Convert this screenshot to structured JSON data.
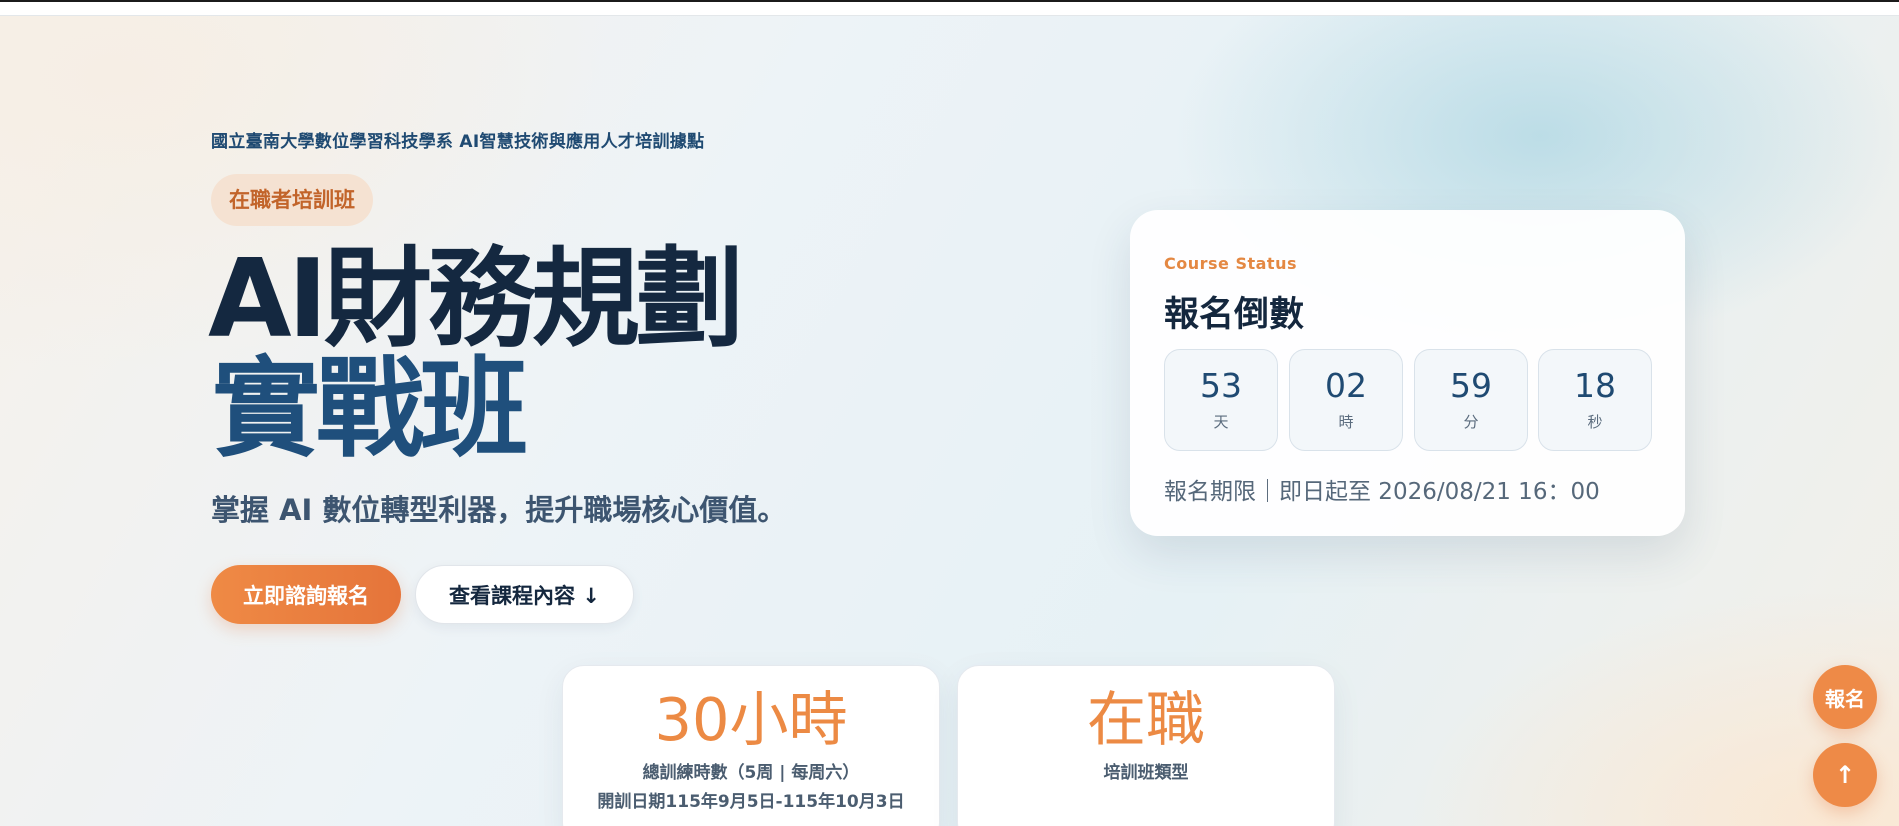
{
  "hero": {
    "institution": "國立臺南大學數位學習科技學系 AI智慧技術與應用人才培訓據點",
    "badge": "在職者培訓班",
    "title_line1": "AI財務規劃",
    "title_line2": "實戰班",
    "subtitle": "掌握 AI 數位轉型利器，提升職場核心價值。",
    "primary_button": "立即諮詢報名",
    "secondary_button": "查看課程內容 ↓"
  },
  "status": {
    "eyebrow": "Course Status",
    "title": "報名倒數",
    "countdown": [
      {
        "value": "53",
        "unit": "天"
      },
      {
        "value": "02",
        "unit": "時"
      },
      {
        "value": "59",
        "unit": "分"
      },
      {
        "value": "18",
        "unit": "秒"
      }
    ],
    "deadline": "報名期限｜即日起至 2026/08/21 16：00"
  },
  "stats": [
    {
      "big": "30小時",
      "label": "總訓練時數（5周 | 每周六）",
      "sub": "開訓日期115年9月5日-115年10月3日"
    },
    {
      "big": "在職",
      "label": "培訓班類型",
      "sub": ""
    }
  ],
  "floating": {
    "signup": "報名",
    "back_to_top": "↑"
  },
  "colors": {
    "accent": "#ee8a47",
    "navy": "#142840",
    "blue": "#1f4f7c"
  }
}
